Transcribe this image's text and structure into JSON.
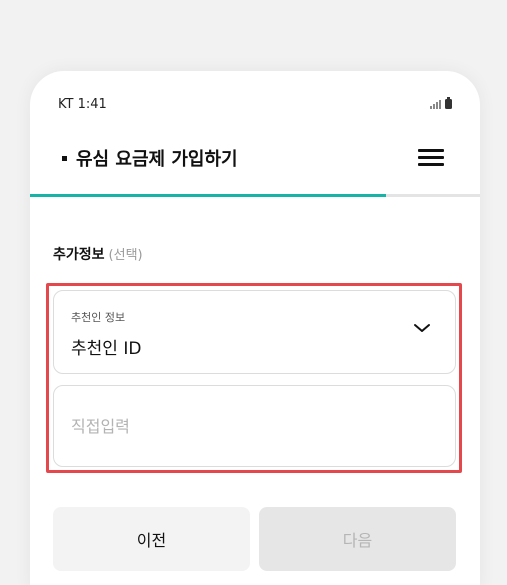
{
  "status_bar": {
    "carrier_time": "KT  1:41"
  },
  "header": {
    "title": "유심 요금제 가입하기"
  },
  "progress": {
    "fraction": 0.79,
    "color": "#17b3a7"
  },
  "section": {
    "title": "추가정보",
    "subtitle": "(선택)"
  },
  "referrer_select": {
    "label": "추천인 정보",
    "value": "추천인 ID"
  },
  "referrer_input": {
    "placeholder": "직접입력",
    "value": ""
  },
  "buttons": {
    "prev": "이전",
    "next": "다음"
  },
  "colors": {
    "highlight": "#e4484d",
    "accent": "#17b3a7"
  },
  "icons": [
    "signal-icon",
    "battery-icon",
    "hamburger-menu-icon",
    "chevron-down-icon"
  ]
}
